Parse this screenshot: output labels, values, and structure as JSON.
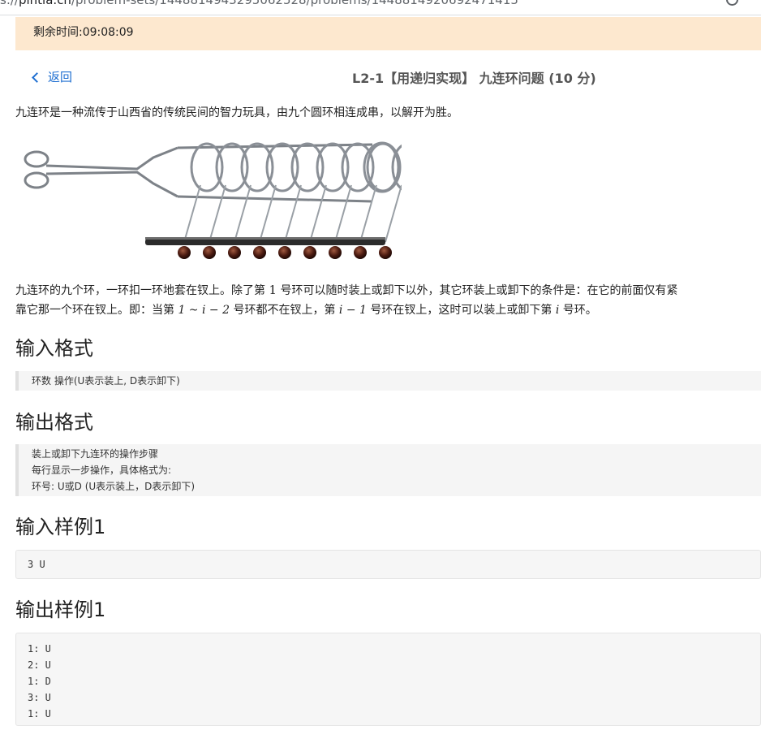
{
  "browser": {
    "url_prefix": "s://",
    "url_domain": "pintia.cn",
    "url_path": "/problem-sets/1448814943295062528/problems/1448814920692471415"
  },
  "timer": {
    "label": "剩余时间:09:08:09"
  },
  "nav": {
    "back_label": "返回"
  },
  "problem": {
    "title": "L2-1【用递归实现】 九连环问题 (10 分)",
    "intro": "九连环是一种流传于山西省的传统民间的智力玩具，由九个圆环相连成串，以解开为胜。",
    "rule_line1_a": "九连环的九个环，一环扣一环地套在钗上。除了第 ",
    "rule_line1_num": "1",
    "rule_line1_b": " 号环可以随时装上或卸下以外，其它环装上或卸下的条件是：在它的前面仅有紧",
    "rule_line2_a": "靠它那一个环在钗上。即：当第 ",
    "rule_line2_math1": "1 ~ i − 2",
    "rule_line2_b": " 号环都不在钗上，第 ",
    "rule_line2_math2": "i − 1",
    "rule_line2_c": " 号环在钗上，这时可以装上或卸下第 ",
    "rule_line2_math3": "i",
    "rule_line2_d": " 号环。"
  },
  "sections": {
    "input_format": {
      "heading": "输入格式",
      "text": "环数 操作(U表示装上, D表示卸下)"
    },
    "output_format": {
      "heading": "输出格式",
      "lines": [
        "装上或卸下九连环的操作步骤",
        "每行显示一步操作，具体格式为:",
        "环号: U或D (U表示装上，D表示卸下)"
      ]
    },
    "sample_input": {
      "heading": "输入样例1",
      "code": "3 U"
    },
    "sample_output": {
      "heading": "输出样例1",
      "lines": [
        "1: U",
        "2: U",
        "1: D",
        "3: U",
        "1: U"
      ]
    }
  },
  "figure": {
    "ring_count": 9,
    "bead_color": "#4a1a10",
    "metal_color": "#8a8f96"
  },
  "colors": {
    "timer_bg": "#fde8cf",
    "link": "#1f6fd1",
    "title": "#555555"
  }
}
